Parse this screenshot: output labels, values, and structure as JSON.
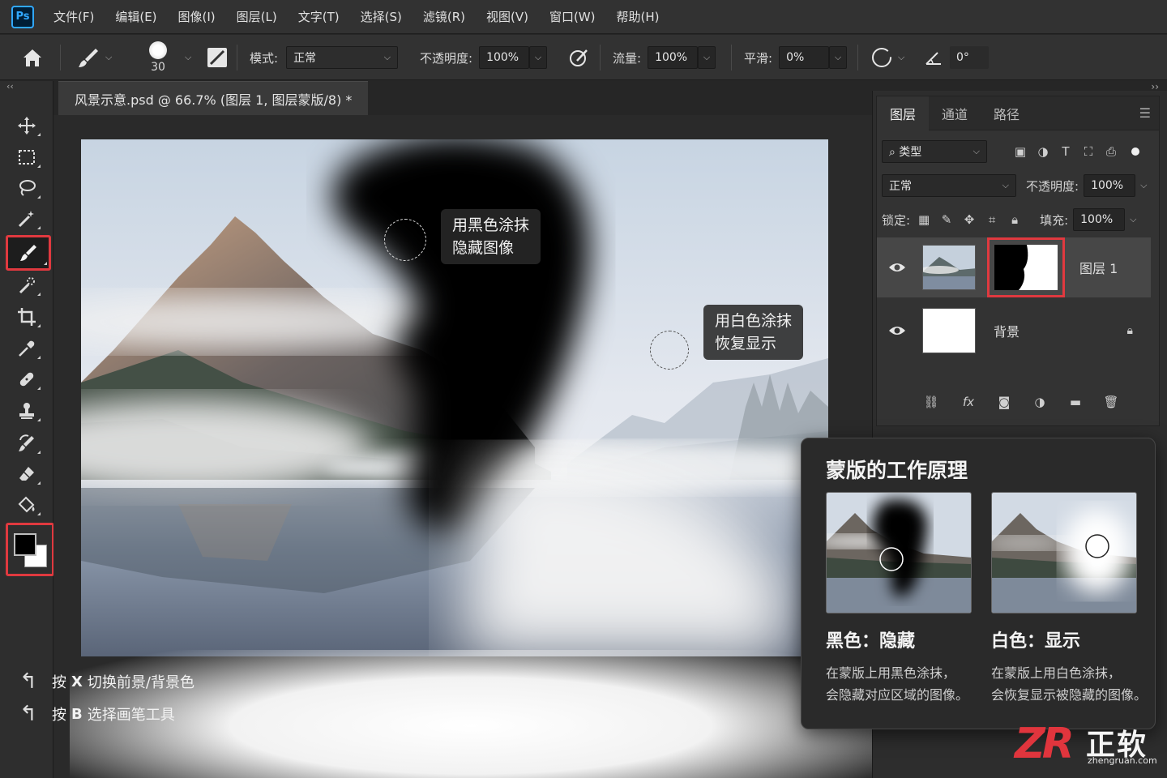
{
  "app": {
    "logo": "Ps",
    "accent": "#31a8ff",
    "highlight": "#e0393f"
  },
  "menu": [
    "文件(F)",
    "编辑(E)",
    "图像(I)",
    "图层(L)",
    "文字(T)",
    "选择(S)",
    "滤镜(R)",
    "视图(V)",
    "窗口(W)",
    "帮助(H)"
  ],
  "options": {
    "brush_size": "30",
    "mode_label": "模式:",
    "mode_value": "正常",
    "opacity_label": "不透明度:",
    "opacity_value": "100%",
    "flow_label": "流量:",
    "flow_value": "100%",
    "smooth_label": "平滑:",
    "smooth_value": "0%",
    "angle_value": "0°"
  },
  "document": {
    "tab_title": "风景示意.psd @ 66.7% (图层 1, 图层蒙版/8) *"
  },
  "canvas": {
    "callout_black": [
      "用黑色涂抹",
      "隐藏图像"
    ],
    "callout_white": [
      "用白色涂抹",
      "恢复显示"
    ]
  },
  "hints": [
    {
      "pre": "按",
      "key": "X",
      "text": "切换前景/背景色"
    },
    {
      "pre": "按",
      "key": "B",
      "text": "选择画笔工具"
    }
  ],
  "tools": [
    "move-icon",
    "marquee-icon",
    "lasso-icon",
    "magic-wand-icon",
    "brush-icon",
    "quick-select-icon",
    "crop-icon",
    "eyedropper-icon",
    "healing-icon",
    "stamp-icon",
    "history-brush-icon",
    "eraser-icon",
    "bucket-icon",
    "smudge-icon",
    "dodge-icon",
    "pen-icon"
  ],
  "layers_panel": {
    "tabs": [
      "图层",
      "通道",
      "路径"
    ],
    "filter_label": "类型",
    "blend_mode": "正常",
    "opacity_label": "不透明度:",
    "opacity_value": "100%",
    "lock_label": "锁定:",
    "fill_label": "填充:",
    "fill_value": "100%",
    "layers": [
      {
        "name": "图层 1"
      },
      {
        "name": "背景"
      }
    ]
  },
  "info_card": {
    "title": "蒙版的工作原理",
    "black_label": "黑色：隐藏",
    "black_desc": [
      "在蒙版上用黑色涂抹，",
      "会隐藏对应区域的图像。"
    ],
    "white_label": "白色：显示",
    "white_desc": [
      "在蒙版上用白色涂抹，",
      "会恢复显示被隐藏的图像。"
    ]
  },
  "watermark": {
    "mark": "ZR",
    "name": "正软",
    "url": "zhengruan.com"
  }
}
